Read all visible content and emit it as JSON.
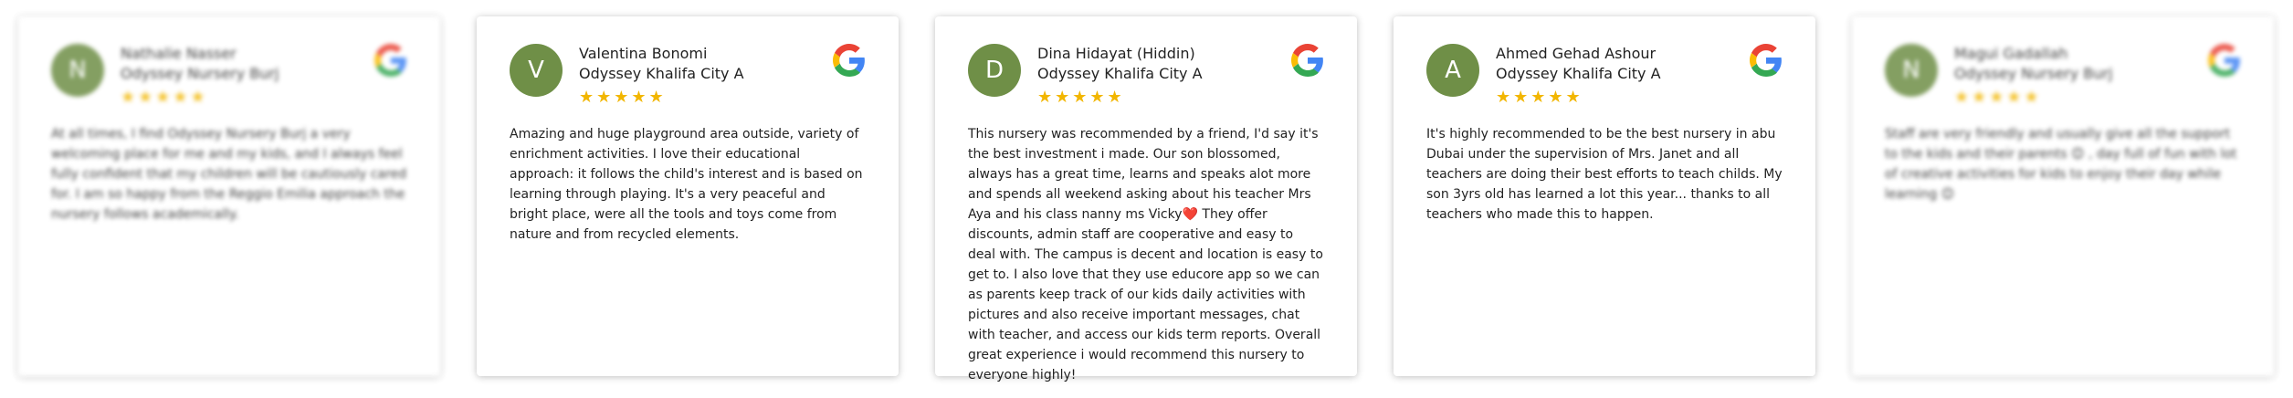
{
  "reviews": [
    {
      "initial": "N",
      "name": "Nathalie Nasser",
      "branch": "Odyssey Nursery Burj",
      "stars": "★★★★★",
      "text": "At all times, I find Odyssey Nursery Burj a very welcoming place for me and my kids, and I always feel fully confident that my children will be cautiously cared for. I am so happy from the Reggio Emilia approach the nursery follows academically."
    },
    {
      "initial": "V",
      "name": "Valentina Bonomi",
      "branch": "Odyssey Khalifa City A",
      "stars": "★★★★★",
      "text": "Amazing and huge playground area outside, variety of enrichment activities. I love their educational approach: it follows the child's interest and is based on learning through playing. It's a very peaceful and bright place, were all the tools and toys come from nature and from recycled elements."
    },
    {
      "initial": "D",
      "name": "Dina Hidayat (Hiddin)",
      "branch": "Odyssey Khalifa City A",
      "stars": "★★★★★",
      "text": "This nursery was recommended by a friend, I'd say it's the best investment i made. Our son blossomed, always has a great time, learns and speaks alot more and spends all weekend asking about his teacher Mrs Aya and his class nanny ms Vicky❤️ They offer discounts, admin staff are cooperative and easy to deal with. The campus is decent and location is easy to get to. I also love that they use educore app so we can as parents keep track of our kids daily activities with pictures and also receive important messages, chat with teacher, and access our kids term reports. Overall great experience i would recommend this nursery to everyone highly!"
    },
    {
      "initial": "A",
      "name": "Ahmed Gehad Ashour",
      "branch": "Odyssey Khalifa City A",
      "stars": "★★★★★",
      "text": "It's highly recommended to be the best nursery in abu Dubai under the supervision of Mrs. Janet and all teachers are doing their best efforts to teach childs. My son 3yrs old has learned a lot this year... thanks to all teachers who made this to happen."
    },
    {
      "initial": "N",
      "name": "Magui Gadallah",
      "branch": "Odyssey Nursery Burj",
      "stars": "★★★★★",
      "text": "Staff are very friendly and usually give all the support to the kids and their parents 😊 , day full of fun with lot of creative activities for kids to enjoy their day while learning 😊"
    }
  ],
  "colors": {
    "avatar": "#6f8f47",
    "star": "#f2b600"
  },
  "icons": {
    "source": "google-g-icon"
  }
}
